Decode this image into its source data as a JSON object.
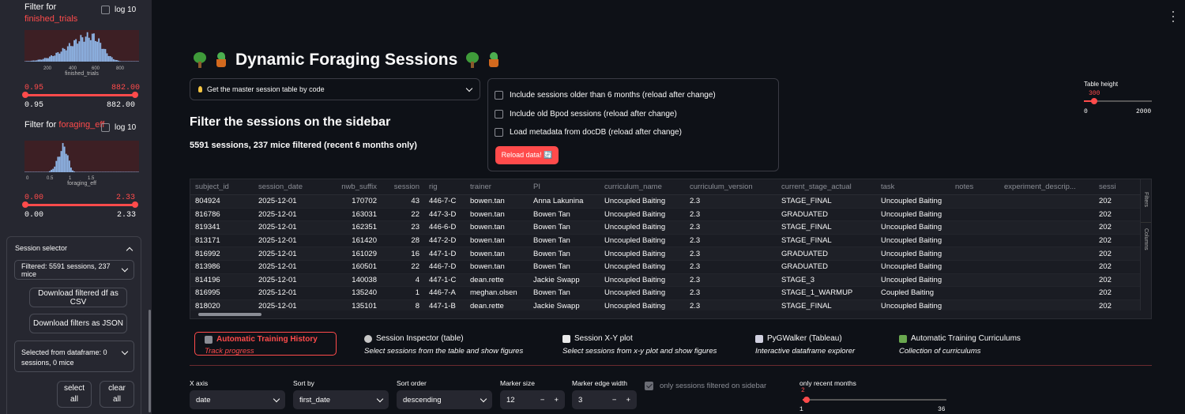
{
  "sidebar": {
    "filter1": {
      "prefix": "Filter for",
      "field": "finished_trials",
      "log_label": "log 10",
      "axis_ticks": [
        "200",
        "400",
        "600",
        "800"
      ],
      "axis_label": "finished_trials",
      "min_sel": "0.95",
      "max_sel": "882.00",
      "min_val": "0.95",
      "max_val": "882.00"
    },
    "filter2": {
      "prefix": "Filter for",
      "field": "foraging_eff",
      "log_label": "log 10",
      "axis_ticks": [
        "0",
        "0.5",
        "1",
        "1.5"
      ],
      "axis_label": "foraging_eff",
      "min_sel": "0.00",
      "max_sel": "2.33",
      "min_val": "0.00",
      "max_val": "2.33"
    },
    "session_selector": {
      "title": "Session selector",
      "filtered": "Filtered: 5591 sessions, 237 mice",
      "download_csv": "Download filtered df as CSV",
      "download_json": "Download filters as JSON",
      "selected": "Selected from dataframe: 0 sessions, 0 mice",
      "select_all": "select all",
      "clear_all": "clear all"
    }
  },
  "header": {
    "title": "Dynamic Foraging Sessions"
  },
  "expander": {
    "label": "Get the master session table by code"
  },
  "filter_heading": "Filter the sessions on the sidebar",
  "count_line": "5591 sessions, 237 mice filtered (recent 6 months only)",
  "options": {
    "older": "Include sessions older than 6 months (reload after change)",
    "bpod": "Include old Bpod sessions (reload after change)",
    "docdb": "Load metadata from docDB (reload after change)",
    "reload": "Reload data! 🔄"
  },
  "table_height": {
    "label": "Table height",
    "value": "300",
    "min": "0",
    "max": "2000",
    "fraction": 0.15
  },
  "table": {
    "columns": [
      "subject_id",
      "session_date",
      "nwb_suffix",
      "session",
      "rig",
      "trainer",
      "PI",
      "curriculum_name",
      "curriculum_version",
      "current_stage_actual",
      "task",
      "notes",
      "experiment_descrip...",
      "sessi"
    ],
    "rows": [
      [
        "804924",
        "2025-12-01",
        "170702",
        "43",
        "446-7-C",
        "bowen.tan",
        "Anna Lakunina",
        "Uncoupled Baiting",
        "2.3",
        "STAGE_FINAL",
        "Uncoupled Baiting",
        "",
        "",
        "202"
      ],
      [
        "816786",
        "2025-12-01",
        "163031",
        "22",
        "447-3-D",
        "bowen.tan",
        "Bowen Tan",
        "Uncoupled Baiting",
        "2.3",
        "GRADUATED",
        "Uncoupled Baiting",
        "",
        "",
        "202"
      ],
      [
        "819341",
        "2025-12-01",
        "162351",
        "23",
        "446-6-D",
        "bowen.tan",
        "Bowen Tan",
        "Uncoupled Baiting",
        "2.3",
        "STAGE_FINAL",
        "Uncoupled Baiting",
        "",
        "",
        "202"
      ],
      [
        "813171",
        "2025-12-01",
        "161420",
        "28",
        "447-2-D",
        "bowen.tan",
        "Bowen Tan",
        "Uncoupled Baiting",
        "2.3",
        "STAGE_FINAL",
        "Uncoupled Baiting",
        "",
        "",
        "202"
      ],
      [
        "816992",
        "2025-12-01",
        "161029",
        "16",
        "447-1-D",
        "bowen.tan",
        "Bowen Tan",
        "Uncoupled Baiting",
        "2.3",
        "GRADUATED",
        "Uncoupled Baiting",
        "",
        "",
        "202"
      ],
      [
        "813986",
        "2025-12-01",
        "160501",
        "22",
        "446-7-D",
        "bowen.tan",
        "Bowen Tan",
        "Uncoupled Baiting",
        "2.3",
        "GRADUATED",
        "Uncoupled Baiting",
        "",
        "",
        "202"
      ],
      [
        "814196",
        "2025-12-01",
        "140038",
        "4",
        "447-1-C",
        "dean.rette",
        "Jackie Swapp",
        "Uncoupled Baiting",
        "2.3",
        "STAGE_3",
        "Uncoupled Baiting",
        "",
        "",
        "202"
      ],
      [
        "816995",
        "2025-12-01",
        "135240",
        "1",
        "446-7-A",
        "meghan.olsen",
        "Bowen Tan",
        "Uncoupled Baiting",
        "2.3",
        "STAGE_1_WARMUP",
        "Coupled Baiting",
        "",
        "",
        "202"
      ],
      [
        "818020",
        "2025-12-01",
        "135101",
        "8",
        "447-1-B",
        "dean.rette",
        "Jackie Swapp",
        "Uncoupled Baiting",
        "2.3",
        "STAGE_FINAL",
        "Uncoupled Baiting",
        "",
        "",
        "202"
      ]
    ],
    "side_filters": "Filters",
    "side_columns": "Columns"
  },
  "tabs": [
    {
      "label": "Automatic Training History",
      "sub": "Track progress"
    },
    {
      "label": "Session Inspector (table)",
      "sub": "Select sessions from the table and show figures"
    },
    {
      "label": "Session X-Y plot",
      "sub": "Select sessions from x-y plot and show figures"
    },
    {
      "label": "PyGWalker (Tableau)",
      "sub": "Interactive dataframe explorer"
    },
    {
      "label": "Automatic Training Curriculums",
      "sub": "Collection of curriculums"
    }
  ],
  "controls": {
    "x_axis": {
      "label": "X axis",
      "value": "date"
    },
    "sort_by": {
      "label": "Sort by",
      "value": "first_date"
    },
    "sort_order": {
      "label": "Sort order",
      "value": "descending"
    },
    "marker_size": {
      "label": "Marker size",
      "value": "12"
    },
    "marker_edge": {
      "label": "Marker edge width",
      "value": "3"
    },
    "only_filtered": "only sessions filtered on sidebar",
    "recent_months": {
      "label": "only recent months",
      "value": "2",
      "min": "1",
      "max": "36",
      "fraction": 0.03
    }
  },
  "colors": {
    "accent": "#ff4b4b",
    "bg": "#0e1117",
    "sidebar": "#262730"
  }
}
